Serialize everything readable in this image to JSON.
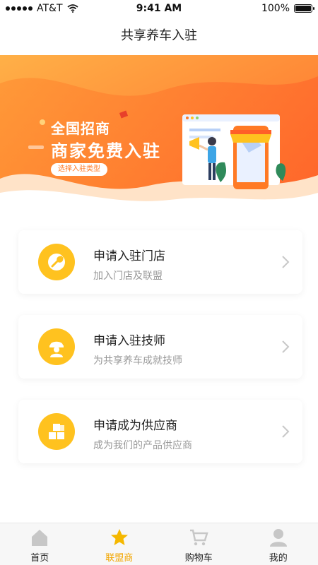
{
  "status_bar": {
    "carrier": "AT&T",
    "time": "9:41 AM",
    "battery": "100%",
    "battery_level": 1.0
  },
  "nav": {
    "title": "共享养车入驻"
  },
  "banner": {
    "title_line1": "全国招商",
    "title_line2": "商家免费入驻",
    "button_label": "选择入驻类型"
  },
  "cards": [
    {
      "title": "申请入驻门店",
      "subtitle": "加入门店及联盟",
      "icon": "wrench-icon"
    },
    {
      "title": "申请入驻技师",
      "subtitle": "为共享养车成就技师",
      "icon": "worker-icon"
    },
    {
      "title": "申请成为供应商",
      "subtitle": "成为我们的产品供应商",
      "icon": "boxes-icon"
    }
  ],
  "tabbar": {
    "items": [
      {
        "label": "首页",
        "icon": "home-icon"
      },
      {
        "label": "联盟商",
        "icon": "star-icon"
      },
      {
        "label": "购物车",
        "icon": "cart-icon"
      },
      {
        "label": "我的",
        "icon": "user-icon"
      }
    ],
    "active_index": 1
  },
  "colors": {
    "accent": "#ffc21f",
    "banner_orange": "#ff7a25",
    "active_tab": "#f2a600"
  }
}
